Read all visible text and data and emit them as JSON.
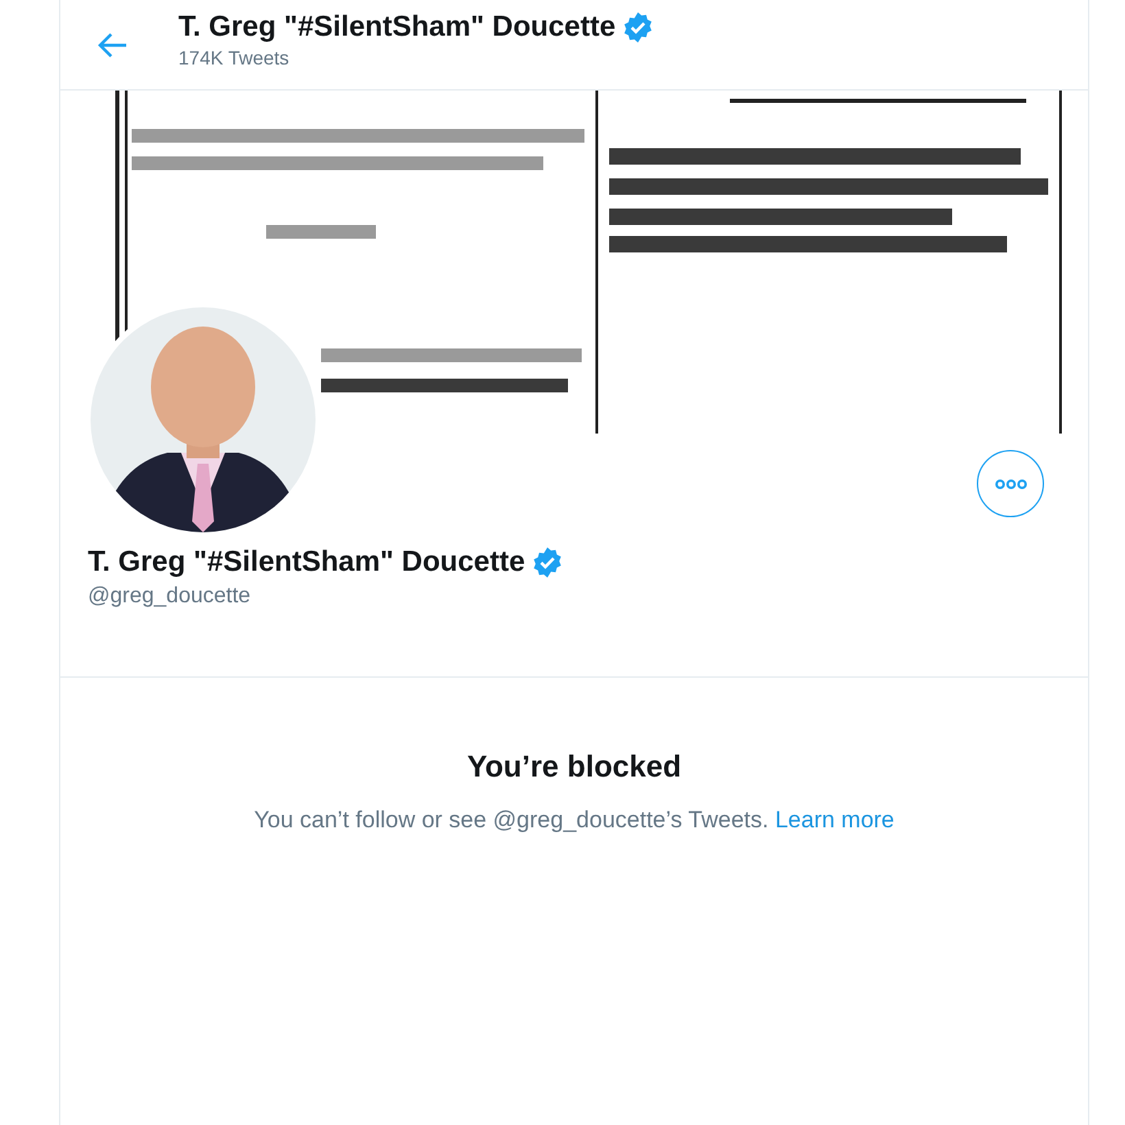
{
  "header": {
    "title": "T. Greg \"#SilentSham\" Doucette",
    "verified": true,
    "subtitle": "174K Tweets"
  },
  "profile": {
    "name": "T. Greg \"#SilentSham\" Doucette",
    "verified": true,
    "handle": "@greg_doucette"
  },
  "blocked": {
    "title": "You’re blocked",
    "message": "You can’t follow or see @greg_doucette’s Tweets.",
    "link": "Learn more"
  }
}
